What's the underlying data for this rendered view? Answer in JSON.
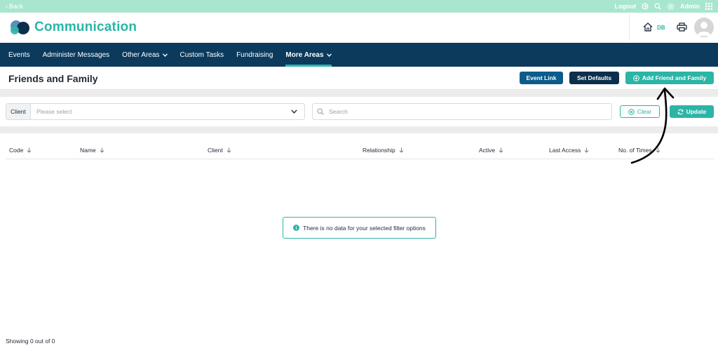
{
  "topbar": {
    "back_label": "Back",
    "logout_label": "Logout",
    "user_label": "Admin",
    "icons": [
      "logout-icon",
      "search-icon",
      "gear-icon",
      "apps-grid-icon"
    ]
  },
  "header": {
    "brand": "Communication",
    "home_badge": "DB",
    "icons": [
      "home-icon",
      "print-icon",
      "avatar"
    ]
  },
  "nav": {
    "items": [
      {
        "label": "Events",
        "dropdown": false,
        "active": false
      },
      {
        "label": "Administer Messages",
        "dropdown": false,
        "active": false
      },
      {
        "label": "Other Areas",
        "dropdown": true,
        "active": false
      },
      {
        "label": "Custom Tasks",
        "dropdown": false,
        "active": false
      },
      {
        "label": "Fundraising",
        "dropdown": false,
        "active": false
      },
      {
        "label": "More Areas",
        "dropdown": true,
        "active": true
      }
    ]
  },
  "page": {
    "title": "Friends and Family",
    "event_link_label": "Event Link",
    "set_defaults_label": "Set Defaults",
    "add_label": "Add Friend and Family"
  },
  "filters": {
    "client_label": "Client",
    "client_placeholder": "Please select",
    "search_placeholder": "Search",
    "clear_label": "Clear",
    "update_label": "Update"
  },
  "table": {
    "columns": [
      "Code",
      "Name",
      "Client",
      "Relationship",
      "Active",
      "Last Access",
      "No. of Times"
    ],
    "empty_message": "There is no data for your selected filter options"
  },
  "footer": {
    "showing_text": "Showing 0 out of 0"
  },
  "colors": {
    "accent": "#2bb5a7",
    "topbar": "#a8e6cf",
    "nav_bg": "#0b3a5c",
    "event_link_btn": "#0b5c8a",
    "set_defaults_btn": "#0b2f4c"
  }
}
